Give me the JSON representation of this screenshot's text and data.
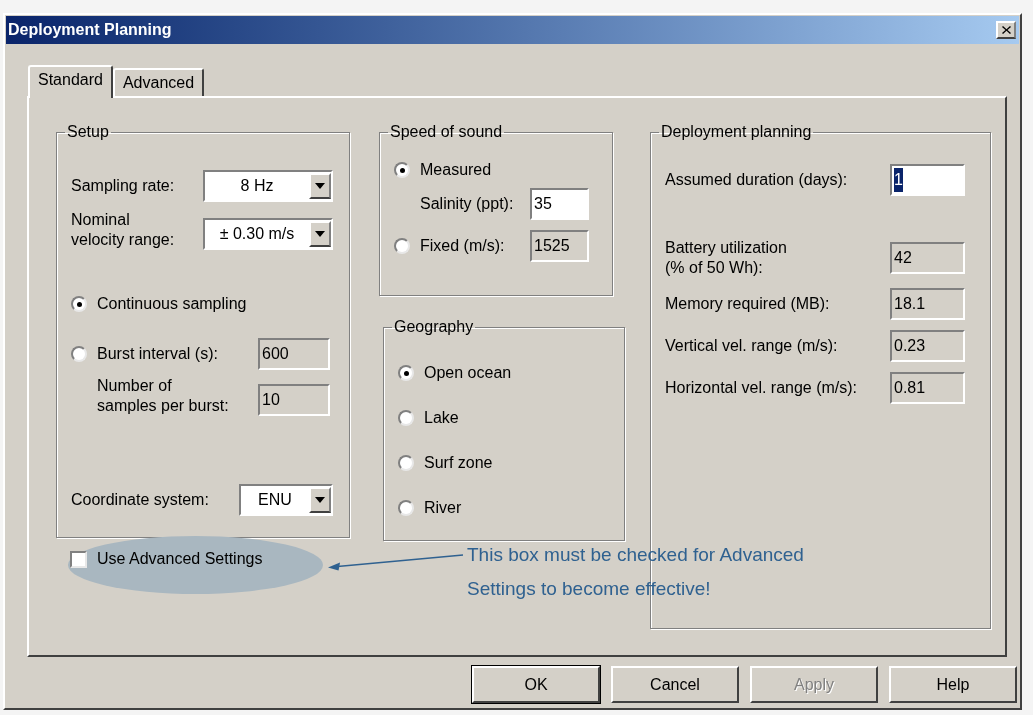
{
  "window": {
    "title": "Deployment Planning"
  },
  "tabs": [
    {
      "label": "Standard",
      "selected": true
    },
    {
      "label": "Advanced",
      "selected": false
    }
  ],
  "setup": {
    "title": "Setup",
    "sampling_rate": {
      "label": "Sampling rate:",
      "value": "8 Hz"
    },
    "velocity_range": {
      "label": "Nominal\nvelocity range:",
      "value": "± 0.30 m/s"
    },
    "modes": [
      {
        "label": "Continuous sampling",
        "selected": true
      },
      {
        "label": "Burst interval (s):",
        "selected": false,
        "value": "600",
        "editable": false
      }
    ],
    "samples_per_burst": {
      "label": "Number of\nsamples per burst:",
      "value": "10",
      "editable": false
    },
    "coordinate_system": {
      "label": "Coordinate system:",
      "value": "ENU"
    }
  },
  "speed_of_sound": {
    "title": "Speed of sound",
    "options": [
      {
        "label": "Measured",
        "selected": true,
        "sub_label": "Salinity (ppt):",
        "value": "35",
        "editable": true
      },
      {
        "label": "Fixed (m/s):",
        "selected": false,
        "value": "1525",
        "editable": false
      }
    ]
  },
  "geography": {
    "title": "Geography",
    "options": [
      {
        "label": "Open ocean",
        "selected": true
      },
      {
        "label": "Lake",
        "selected": false
      },
      {
        "label": "Surf zone",
        "selected": false
      },
      {
        "label": "River",
        "selected": false
      }
    ]
  },
  "deployment_planning": {
    "title": "Deployment planning",
    "duration": {
      "label": "Assumed duration (days):",
      "value": "1",
      "editable": true,
      "text_selected": true
    },
    "outputs": [
      {
        "label": "Battery utilization\n(% of 50 Wh):",
        "value": "42"
      },
      {
        "label": "Memory required (MB):",
        "value": "18.1"
      },
      {
        "label": "Vertical vel. range (m/s):",
        "value": "0.23"
      },
      {
        "label": "Horizontal vel. range (m/s):",
        "value": "0.81"
      }
    ]
  },
  "use_advanced_settings": {
    "label": "Use Advanced Settings",
    "checked": false
  },
  "annotation": {
    "text": "This box must be checked for Advanced\nSettings to become effective!"
  },
  "buttons": [
    {
      "label": "OK",
      "default": true,
      "disabled": false
    },
    {
      "label": "Cancel",
      "default": false,
      "disabled": false
    },
    {
      "label": "Apply",
      "default": false,
      "disabled": true
    },
    {
      "label": "Help",
      "default": false,
      "disabled": false
    }
  ]
}
